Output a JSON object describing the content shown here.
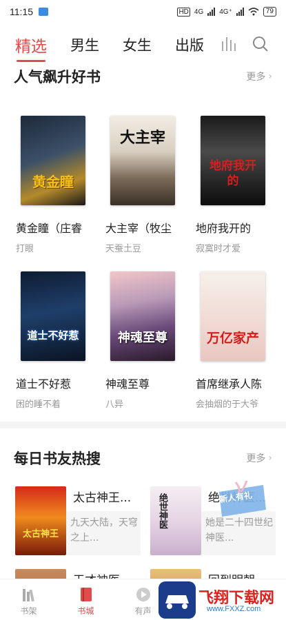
{
  "status_bar": {
    "time": "11:15",
    "network_1": "4G",
    "network_2": "4G⁺",
    "battery": "79"
  },
  "top_tabs": [
    {
      "label": "精选",
      "active": true
    },
    {
      "label": "男生",
      "active": false
    },
    {
      "label": "女生",
      "active": false
    },
    {
      "label": "出版",
      "active": false
    }
  ],
  "section_popular": {
    "title": "人气飙升好书",
    "more": "更多",
    "books": [
      {
        "title": "黄金瞳（庄睿",
        "author": "打眼",
        "cover_text": "黄金瞳"
      },
      {
        "title": "大主宰（牧尘",
        "author": "天蚕土豆",
        "cover_text": "大主宰"
      },
      {
        "title": "地府我开的",
        "author": "寂寞时才爱",
        "cover_text": "地府我开的"
      },
      {
        "title": "道士不好惹",
        "author": "困的睡不着",
        "cover_text": "道士不好惹"
      },
      {
        "title": "神魂至尊",
        "author": "八异",
        "cover_text": "神魂至尊"
      },
      {
        "title": "首席继承人陈",
        "author": "会抽烟的于大爷",
        "cover_text": "万亿家产"
      }
    ]
  },
  "section_hot": {
    "title": "每日书友热搜",
    "more": "更多",
    "items": [
      {
        "title": "太古神王...",
        "desc": "九天大陆，天穹之上...",
        "cover_text": "太古神王"
      },
      {
        "title": "绝世神医...",
        "desc": "她是二十四世纪神医...",
        "cover_text": "绝世神医"
      },
      {
        "title": "天才神医...",
        "desc": "",
        "cover_text": ""
      },
      {
        "title": "回到明朝...",
        "desc": "",
        "cover_text": ""
      }
    ],
    "gift_label": "新人有礼"
  },
  "bottom_nav": [
    {
      "label": "书架",
      "icon": "bookshelf-icon",
      "active": false
    },
    {
      "label": "书城",
      "icon": "bookstore-icon",
      "active": true
    },
    {
      "label": "有声",
      "icon": "audio-icon",
      "active": false
    },
    {
      "label": "",
      "icon": "",
      "active": false
    },
    {
      "label": "",
      "icon": "",
      "active": false
    }
  ],
  "watermark": {
    "text": "飞翔下载网",
    "url": "www.FXXZ.com"
  },
  "colors": {
    "accent": "#e24b4b",
    "muted": "#999999"
  }
}
